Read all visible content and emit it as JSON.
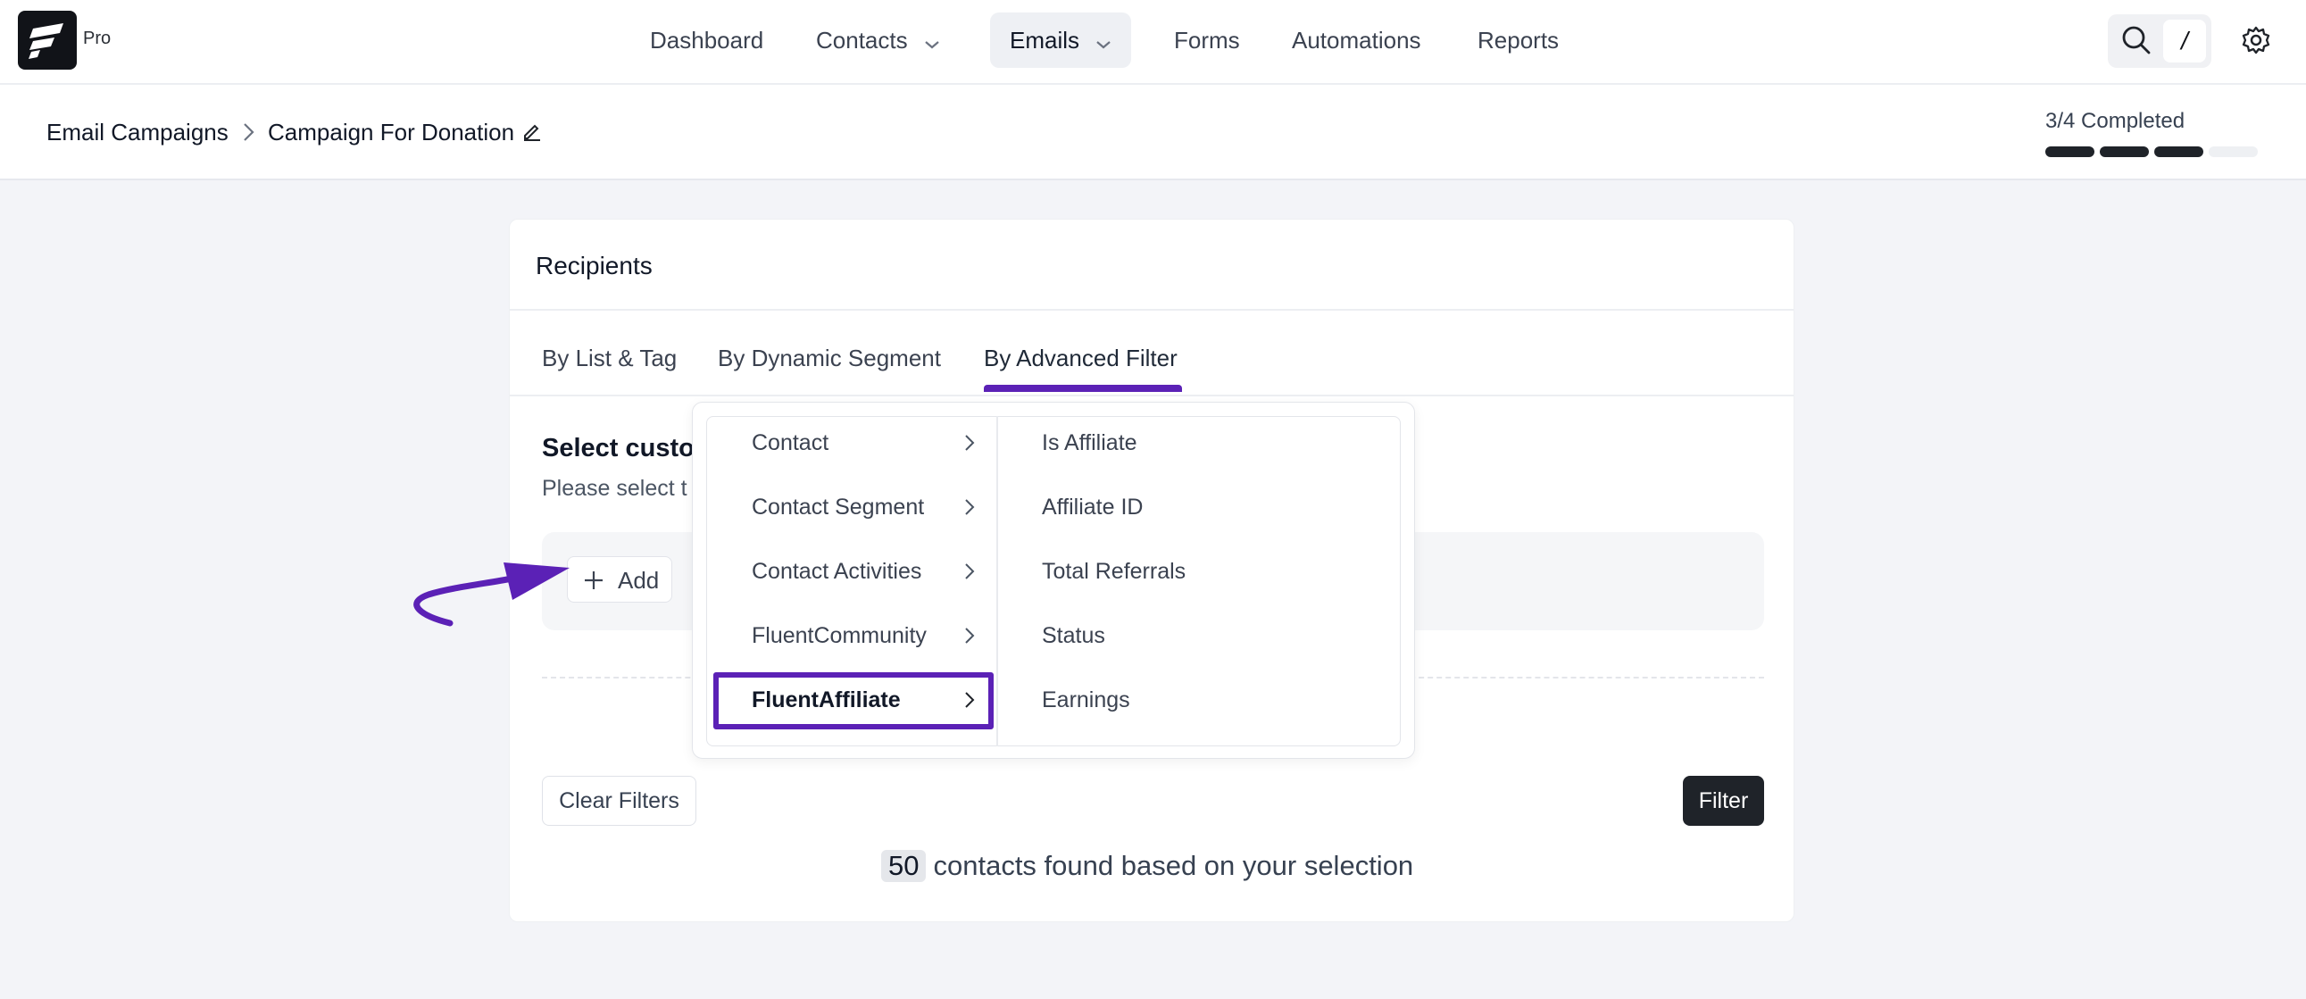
{
  "header": {
    "brand_badge": "Pro",
    "nav": [
      {
        "label": "Dashboard"
      },
      {
        "label": "Contacts"
      },
      {
        "label": "Emails"
      },
      {
        "label": "Forms"
      },
      {
        "label": "Automations"
      },
      {
        "label": "Reports"
      }
    ],
    "shortcut_key": "/"
  },
  "breadcrumb": {
    "parent": "Email Campaigns",
    "current": "Campaign For Donation"
  },
  "progress": {
    "label": "3/4 Completed",
    "completed_steps": 3,
    "total_steps": 4
  },
  "recipients": {
    "title": "Recipients",
    "tabs": [
      {
        "label": "By List & Tag"
      },
      {
        "label": "By Dynamic Segment"
      },
      {
        "label": "By Advanced Filter",
        "active": true
      }
    ],
    "section_title": "Select custor",
    "section_subtitle": "Please select t",
    "add_label": "Add",
    "clear_label": "Clear Filters",
    "filter_label": "Filter",
    "found_count": "50",
    "found_text": "contacts found based on your selection"
  },
  "dropdown": {
    "categories": [
      {
        "label": "Contact"
      },
      {
        "label": "Contact Segment"
      },
      {
        "label": "Contact Activities"
      },
      {
        "label": "FluentCommunity"
      },
      {
        "label": "FluentAffiliate",
        "selected": true
      }
    ],
    "options": [
      {
        "label": "Is Affiliate"
      },
      {
        "label": "Affiliate ID"
      },
      {
        "label": "Total Referrals"
      },
      {
        "label": "Status"
      },
      {
        "label": "Earnings"
      }
    ]
  },
  "colors": {
    "accent": "#5b21b6",
    "dark": "#1f2329"
  }
}
